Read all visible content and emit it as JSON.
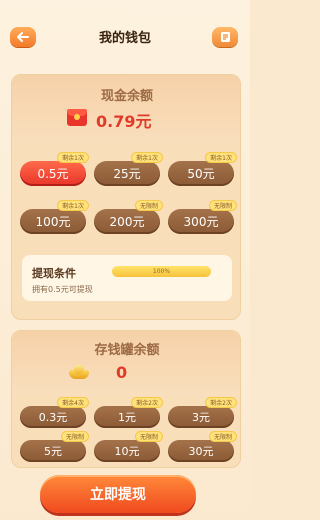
{
  "header": {
    "title": "我的钱包",
    "back_icon": "back-arrow-icon",
    "rules_icon": "document-icon"
  },
  "cash": {
    "title": "现金余额",
    "amount": "0.79元",
    "icon": "red-envelope-icon",
    "options": [
      {
        "label": "0.5元",
        "tag": "剩余1次",
        "selected": true
      },
      {
        "label": "25元",
        "tag": "剩余1次"
      },
      {
        "label": "50元",
        "tag": "剩余1次"
      },
      {
        "label": "100元",
        "tag": "剩余1次"
      },
      {
        "label": "200元",
        "tag": "无限制"
      },
      {
        "label": "300元",
        "tag": "无限制"
      }
    ],
    "condition": {
      "title": "提现条件",
      "progress_text": "100%",
      "progress": 1.0,
      "description": "拥有0.5元可提现"
    }
  },
  "piggy": {
    "title": "存钱罐余额",
    "amount": "0",
    "icon": "gold-ingot-icon",
    "options": [
      {
        "label": "0.3元",
        "tag": "剩余4次"
      },
      {
        "label": "1元",
        "tag": "剩余2次"
      },
      {
        "label": "3元",
        "tag": "剩余2次"
      },
      {
        "label": "5元",
        "tag": "无限制"
      },
      {
        "label": "10元",
        "tag": "无限制"
      },
      {
        "label": "30元",
        "tag": "无限制"
      }
    ]
  },
  "cta": {
    "label": "立即提现"
  },
  "colors": {
    "accent": "#f04a1e",
    "button_brown": "#8a5a36",
    "selected_red": "#e8342a"
  }
}
